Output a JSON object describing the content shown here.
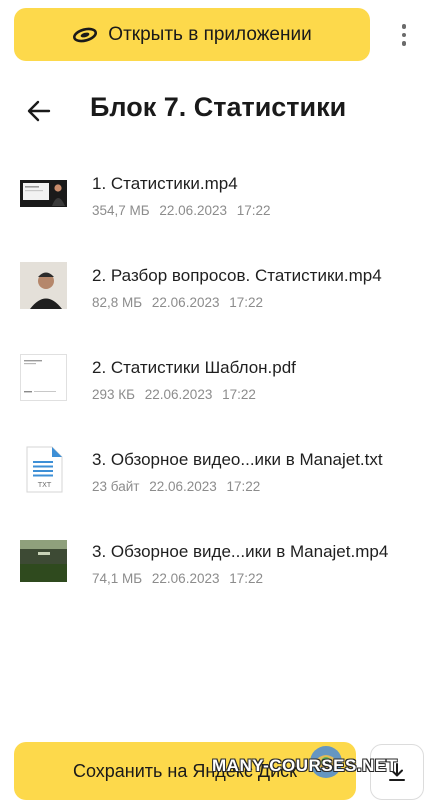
{
  "top_bar": {
    "open_app_label": "Открыть в приложении",
    "open_app_icon": "yandex-disk-icon",
    "menu_icon": "kebab-menu-icon"
  },
  "header": {
    "back_icon": "arrow-left-icon",
    "title": "Блок 7. Статистики"
  },
  "files": [
    {
      "name": "1. Статистики.mp4",
      "size": "354,7 МБ",
      "date": "22.06.2023",
      "time": "17:22",
      "thumb": "video-thumbnail"
    },
    {
      "name": "2. Разбор вопросов. Статистики.mp4",
      "size": "82,8 МБ",
      "date": "22.06.2023",
      "time": "17:22",
      "thumb": "video-thumbnail"
    },
    {
      "name": "2. Статистики Шаблон.pdf",
      "size": "293 КБ",
      "date": "22.06.2023",
      "time": "17:22",
      "thumb": "pdf-thumbnail"
    },
    {
      "name": "3. Обзорное видео...ики в Manajet.txt",
      "size": "23 байт",
      "date": "22.06.2023",
      "time": "17:22",
      "thumb": "txt-file-icon",
      "thumb_label": "TXT"
    },
    {
      "name": "3. Обзорное виде...ики в Manajet.mp4",
      "size": "74,1 МБ",
      "date": "22.06.2023",
      "time": "17:22",
      "thumb": "video-thumbnail"
    }
  ],
  "bottom_bar": {
    "save_label": "Сохранить на Яндекс Диск",
    "download_icon": "download-icon"
  },
  "watermark": {
    "text": "MANY-COURSES.NET"
  },
  "colors": {
    "accent_yellow": "#fdd94b",
    "text_primary": "#1f1f1f",
    "text_secondary": "#8c8c8c",
    "txt_icon_blue": "#3d8fd6"
  }
}
